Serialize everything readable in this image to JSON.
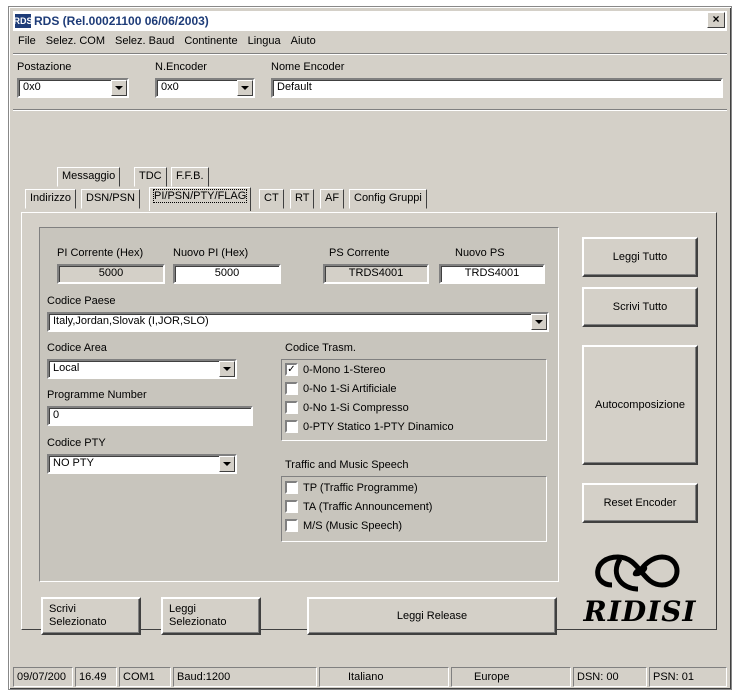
{
  "window": {
    "title": "RDS (Rel.00021100 06/06/2003)",
    "icon_label": "RDS"
  },
  "menu": [
    "File",
    "Selez. COM",
    "Selez. Baud",
    "Continente",
    "Lingua",
    "Aiuto"
  ],
  "top": {
    "postazione_label": "Postazione",
    "postazione_value": "0x0",
    "n_encoder_label": "N.Encoder",
    "n_encoder_value": "0x0",
    "nome_encoder_label": "Nome Encoder",
    "nome_encoder_value": "Default"
  },
  "tabs_row1": [
    "Messaggio",
    "TDC",
    "F.F.B."
  ],
  "tabs_row2": [
    "Indirizzo",
    "DSN/PSN",
    "PI/PSN/PTY/FLAG",
    "CT",
    "RT",
    "AF",
    "Config Gruppi"
  ],
  "active_tab": "PI/PSN/PTY/FLAG",
  "pi": {
    "pi_corrente_label": "PI Corrente (Hex)",
    "pi_corrente_value": "5000",
    "nuovo_pi_label": "Nuovo PI (Hex)",
    "nuovo_pi_value": "5000",
    "ps_corrente_label": "PS Corrente",
    "ps_corrente_value": "TRDS4001",
    "nuovo_ps_label": "Nuovo PS",
    "nuovo_ps_value": "TRDS4001"
  },
  "codice_paese": {
    "label": "Codice Paese",
    "value": "Italy,Jordan,Slovak (I,JOR,SLO)"
  },
  "codice_area": {
    "label": "Codice Area",
    "value": "Local"
  },
  "programme_number": {
    "label": "Programme Number",
    "value": "0"
  },
  "codice_pty": {
    "label": "Codice PTY",
    "value": "NO PTY"
  },
  "codice_trasm": {
    "label": "Codice Trasm.",
    "options": [
      {
        "label": "0-Mono 1-Stereo",
        "checked": true,
        "mark": "✓"
      },
      {
        "label": "0-No 1-Si Artificiale",
        "checked": false,
        "mark": ""
      },
      {
        "label": "0-No 1-Si Compresso",
        "checked": false,
        "mark": ""
      },
      {
        "label": "0-PTY Statico 1-PTY Dinamico",
        "checked": false,
        "mark": ""
      }
    ]
  },
  "traffic": {
    "label": "Traffic and Music Speech",
    "options": [
      {
        "label": "TP (Traffic Programme)",
        "checked": false,
        "mark": ""
      },
      {
        "label": "TA (Traffic Announcement)",
        "checked": false,
        "mark": ""
      },
      {
        "label": "M/S (Music Speech)",
        "checked": false,
        "mark": ""
      }
    ]
  },
  "side_buttons": {
    "leggi_tutto": "Leggi Tutto",
    "scrivi_tutto": "Scrivi Tutto",
    "autocomposizione": "Autocomposizione",
    "reset_encoder": "Reset Encoder"
  },
  "bottom_buttons": {
    "scrivi_selezionato_1": "Scrivi",
    "scrivi_selezionato_2": "Selezionato",
    "leggi_selezionato_1": "Leggi",
    "leggi_selezionato_2": "Selezionato",
    "leggi_release": "Leggi Release"
  },
  "logo_text": "RIDISI",
  "status": {
    "date": "09/07/200",
    "time": "16.49",
    "com": "COM1",
    "baud": "Baud:1200",
    "language": "Italiano",
    "continent": "Europe",
    "dsn": "DSN: 00",
    "psn": "PSN: 01"
  }
}
